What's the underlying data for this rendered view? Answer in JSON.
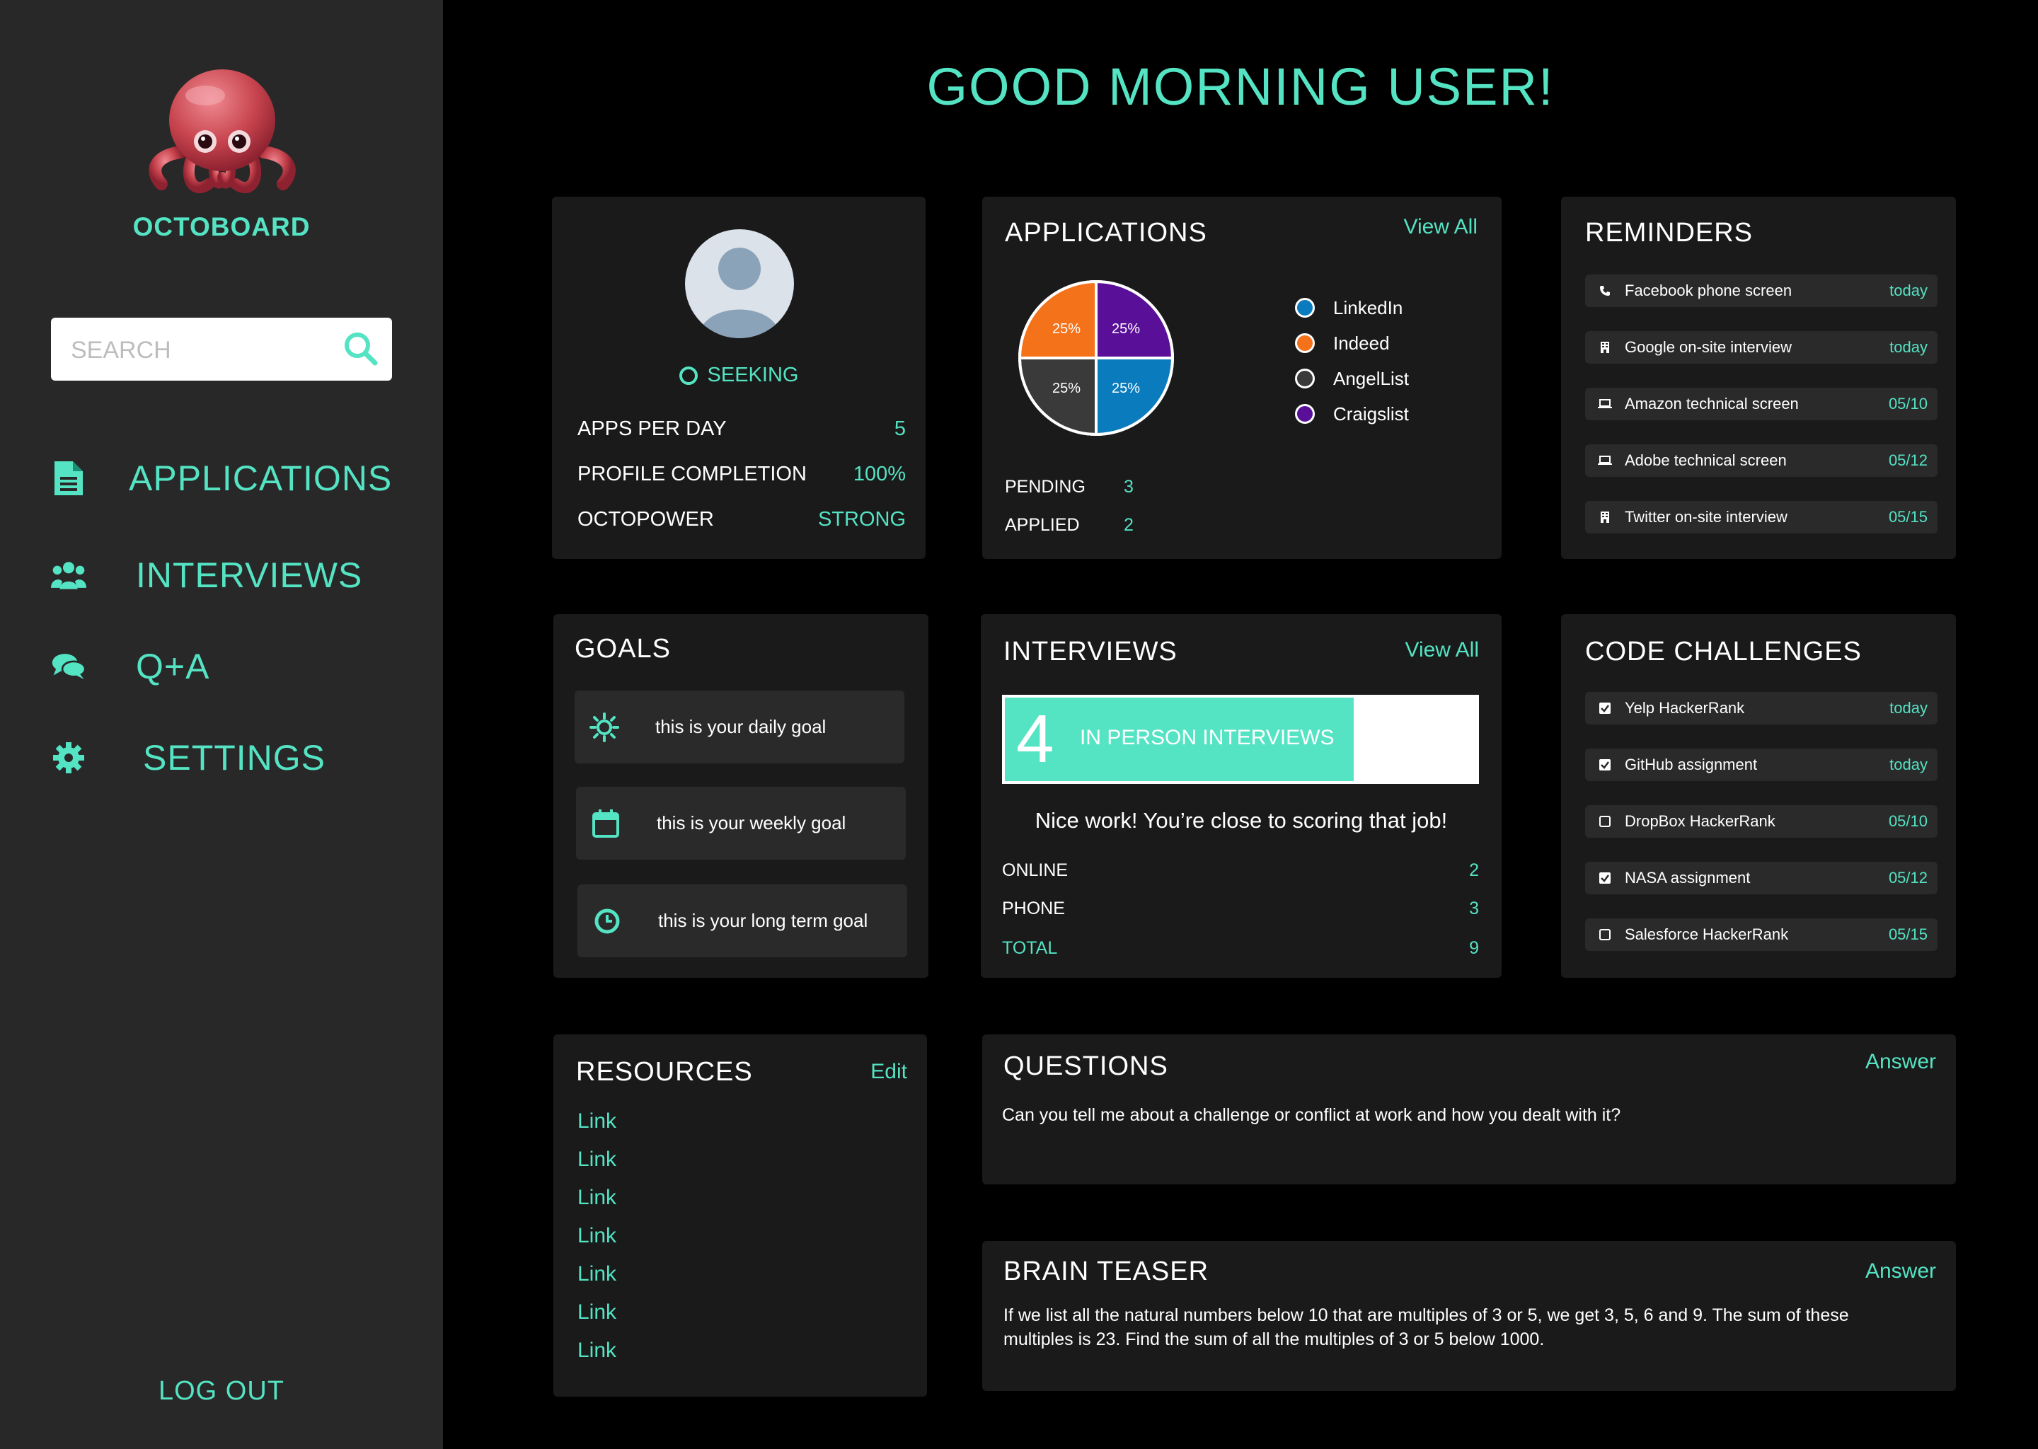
{
  "app": {
    "name": "OCTOBOARD"
  },
  "greeting": "GOOD MORNING USER!",
  "search": {
    "placeholder": "SEARCH"
  },
  "nav": [
    {
      "label": "APPLICATIONS",
      "icon": "document-icon"
    },
    {
      "label": "INTERVIEWS",
      "icon": "users-icon"
    },
    {
      "label": "Q+A",
      "icon": "chat-icon"
    },
    {
      "label": "SETTINGS",
      "icon": "gear-icon"
    }
  ],
  "logout_label": "LOG OUT",
  "profile": {
    "status": "SEEKING",
    "stats": [
      {
        "label": "APPS PER DAY",
        "value": "5"
      },
      {
        "label": "PROFILE COMPLETION",
        "value": "100%"
      },
      {
        "label": "OCTOPOWER",
        "value": "STRONG"
      }
    ]
  },
  "applications": {
    "title": "APPLICATIONS",
    "view_all": "View All",
    "slice_labels": [
      "25%",
      "25%",
      "25%",
      "25%"
    ],
    "legend": [
      {
        "name": "LinkedIn",
        "color": "#0a7bbd"
      },
      {
        "name": "Indeed",
        "color": "#f4721a"
      },
      {
        "name": "AngelList",
        "color": "#3a3a3a"
      },
      {
        "name": "Craigslist",
        "color": "#5a0f99"
      }
    ],
    "counts": [
      {
        "label": "PENDING",
        "value": "3"
      },
      {
        "label": "APPLIED",
        "value": "2"
      }
    ]
  },
  "chart_data": {
    "type": "pie",
    "categories": [
      "Indeed",
      "Craigslist",
      "LinkedIn",
      "AngelList"
    ],
    "values": [
      25,
      25,
      25,
      25
    ],
    "title": "",
    "colors": [
      "#f4721a",
      "#5a0f99",
      "#0a7bbd",
      "#3a3a3a"
    ]
  },
  "reminders": {
    "title": "REMINDERS",
    "items": [
      {
        "text": "Facebook phone screen",
        "date": "today",
        "icon": "phone-icon"
      },
      {
        "text": "Google on-site interview",
        "date": "today",
        "icon": "building-icon"
      },
      {
        "text": "Amazon technical screen",
        "date": "05/10",
        "icon": "laptop-icon"
      },
      {
        "text": "Adobe technical screen",
        "date": "05/12",
        "icon": "laptop-icon"
      },
      {
        "text": "Twitter on-site interview",
        "date": "05/15",
        "icon": "building-icon"
      }
    ]
  },
  "goals": {
    "title": "GOALS",
    "items": [
      {
        "text": "this is your daily goal",
        "icon": "sun-icon"
      },
      {
        "text": "this is your weekly goal",
        "icon": "calendar-icon"
      },
      {
        "text": "this is your long term goal",
        "icon": "clock-icon"
      }
    ]
  },
  "interviews": {
    "title": "INTERVIEWS",
    "view_all": "View All",
    "big_number": "4",
    "bar_label": "IN PERSON INTERVIEWS",
    "progress_fraction": 0.74,
    "message": "Nice work! You’re close to scoring that job!",
    "rows": [
      {
        "label": "ONLINE",
        "value": "2"
      },
      {
        "label": "PHONE",
        "value": "3"
      }
    ],
    "total": {
      "label": "TOTAL",
      "value": "9"
    }
  },
  "code_challenges": {
    "title": "CODE CHALLENGES",
    "items": [
      {
        "text": "Yelp HackerRank",
        "date": "today",
        "checked": true
      },
      {
        "text": "GitHub assignment",
        "date": "today",
        "checked": true
      },
      {
        "text": "DropBox HackerRank",
        "date": "05/10",
        "checked": false
      },
      {
        "text": "NASA assignment",
        "date": "05/12",
        "checked": true
      },
      {
        "text": "Salesforce HackerRank",
        "date": "05/15",
        "checked": false
      }
    ]
  },
  "resources": {
    "title": "RESOURCES",
    "edit_label": "Edit",
    "links": [
      "Link",
      "Link",
      "Link",
      "Link",
      "Link",
      "Link",
      "Link"
    ]
  },
  "questions": {
    "title": "QUESTIONS",
    "answer_label": "Answer",
    "text": "Can you tell me about a challenge or conflict at work and how you dealt with it?"
  },
  "brain_teaser": {
    "title": "BRAIN TEASER",
    "answer_label": "Answer",
    "text": "If we list all the natural numbers below 10 that are multiples of 3 or 5, we get 3, 5, 6 and 9. The sum of these multiples is 23. Find the sum of all the multiples of 3 or 5 below 1000."
  },
  "colors": {
    "accent": "#54e3c3",
    "card_bg": "#1a1a1a",
    "sidebar_bg": "#282828",
    "pill_bg": "#2a2a2a"
  }
}
